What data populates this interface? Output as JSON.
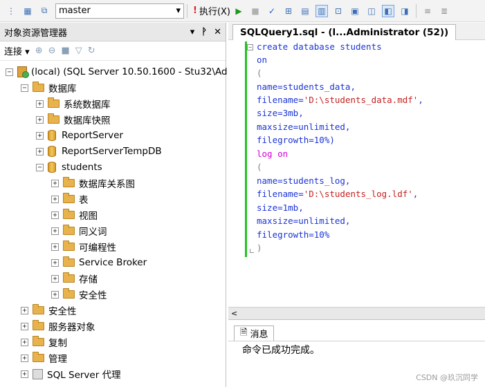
{
  "toolbar": {
    "database": "master",
    "execute_label": "执行(X)"
  },
  "object_explorer": {
    "title": "对象资源管理器",
    "connect_label": "连接",
    "nodes": [
      {
        "id": "server",
        "label": "(local) (SQL Server 10.50.1600 - Stu32\\Ad",
        "icon": "server-icon",
        "expander": "−"
      },
      {
        "id": "databases",
        "label": "数据库",
        "icon": "folder-icon",
        "expander": "−"
      },
      {
        "id": "system-db",
        "label": "系统数据库",
        "icon": "folder-icon",
        "expander": "+"
      },
      {
        "id": "db-snapshots",
        "label": "数据库快照",
        "icon": "folder-icon",
        "expander": "+"
      },
      {
        "id": "reportserver",
        "label": "ReportServer",
        "icon": "database-icon",
        "expander": "+"
      },
      {
        "id": "reportservertempdb",
        "label": "ReportServerTempDB",
        "icon": "database-icon",
        "expander": "+"
      },
      {
        "id": "students",
        "label": "students",
        "icon": "database-icon",
        "expander": "−"
      },
      {
        "id": "diagrams",
        "label": "数据库关系图",
        "icon": "folder-icon",
        "expander": "+"
      },
      {
        "id": "tables",
        "label": "表",
        "icon": "folder-icon",
        "expander": "+"
      },
      {
        "id": "views",
        "label": "视图",
        "icon": "folder-icon",
        "expander": "+"
      },
      {
        "id": "synonyms",
        "label": "同义词",
        "icon": "folder-icon",
        "expander": "+"
      },
      {
        "id": "programmability",
        "label": "可编程性",
        "icon": "folder-icon",
        "expander": "+"
      },
      {
        "id": "service-broker",
        "label": "Service Broker",
        "icon": "folder-icon",
        "expander": "+"
      },
      {
        "id": "storage",
        "label": "存储",
        "icon": "folder-icon",
        "expander": "+"
      },
      {
        "id": "security-db",
        "label": "安全性",
        "icon": "folder-icon",
        "expander": "+"
      },
      {
        "id": "security",
        "label": "安全性",
        "icon": "folder-icon",
        "expander": "+"
      },
      {
        "id": "server-objects",
        "label": "服务器对象",
        "icon": "folder-icon",
        "expander": "+"
      },
      {
        "id": "replication",
        "label": "复制",
        "icon": "folder-icon",
        "expander": "+"
      },
      {
        "id": "management",
        "label": "管理",
        "icon": "folder-icon",
        "expander": "+"
      },
      {
        "id": "sql-agent",
        "label": "SQL Server 代理",
        "icon": "agent-icon",
        "expander": "+"
      }
    ]
  },
  "editor": {
    "tab_title": "SQLQuery1.sql - (l...Administrator (52))",
    "code": [
      "create database students",
      "on",
      "(",
      "name=students_data,",
      "filename='D:\\students_data.mdf',",
      "size=3mb,",
      "maxsize=unlimited,",
      "filegrowth=10%)",
      "log on",
      "(",
      "name=students_log,",
      "filename='D:\\students_log.ldf',",
      "size=1mb,",
      "maxsize=unlimited,",
      "filegrowth=10%",
      ")"
    ]
  },
  "messages": {
    "tab_label": "消息",
    "text": "命令已成功完成。"
  },
  "watermark": "CSDN @玖沉同学",
  "colors": {
    "keyword": "#1a33d6",
    "string": "#c42020",
    "change_bar": "#22c222"
  }
}
